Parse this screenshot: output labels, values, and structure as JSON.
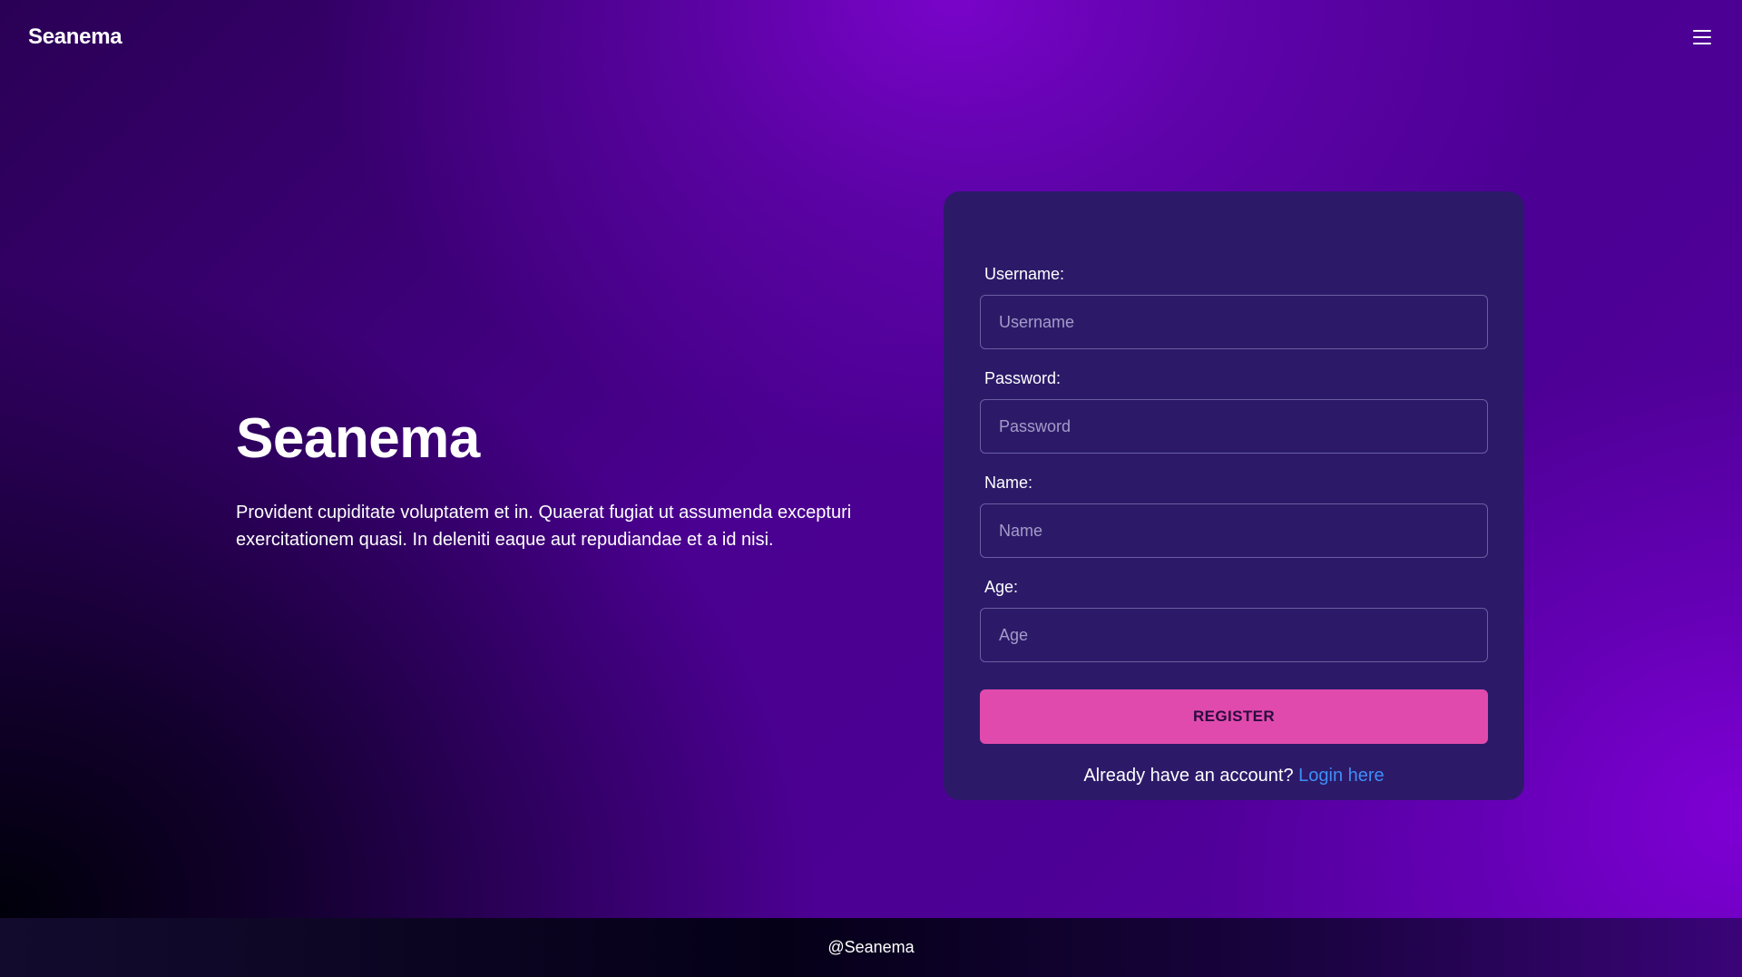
{
  "navbar": {
    "brand": "Seanema",
    "menu_icon": "hamburger-menu-icon"
  },
  "hero": {
    "title": "Seanema",
    "description": "Provident cupiditate voluptatem et in. Quaerat fugiat ut assumenda excepturi exercitationem quasi. In deleniti eaque aut repudiandae et a id nisi."
  },
  "form": {
    "username": {
      "label": "Username:",
      "placeholder": "Username",
      "value": ""
    },
    "password": {
      "label": "Password:",
      "placeholder": "Password",
      "value": ""
    },
    "name": {
      "label": "Name:",
      "placeholder": "Name",
      "value": ""
    },
    "age": {
      "label": "Age:",
      "placeholder": "Age",
      "value": ""
    },
    "submit_label": "REGISTER",
    "login_prompt": "Already have an account?",
    "login_link": "Login here"
  },
  "footer": {
    "text": "@Seanema"
  },
  "colors": {
    "card_background": "#2c1a69",
    "button_accent": "#e14aad",
    "link": "#3e8ef7"
  }
}
